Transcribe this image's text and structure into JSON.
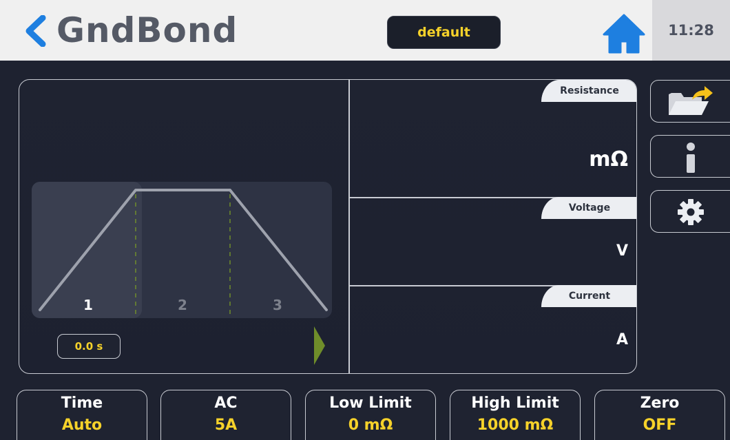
{
  "header": {
    "title": "GndBond",
    "profile": "default",
    "clock": "11:28",
    "icons": {
      "back": "chevron-left-icon",
      "home": "home-icon"
    },
    "colors": {
      "accent_blue": "#1e7fe0",
      "value_yellow": "#f6d22a",
      "play_green": "#6f8d2a"
    }
  },
  "graph": {
    "step_labels": [
      "1",
      "2",
      "3"
    ],
    "active_step": 1,
    "timer": "0.0 s"
  },
  "measurements": [
    {
      "label": "Resistance",
      "unit": "mΩ"
    },
    {
      "label": "Voltage",
      "unit": "V"
    },
    {
      "label": "Current",
      "unit": "A"
    }
  ],
  "side_buttons": [
    {
      "icon": "folder-open-icon"
    },
    {
      "icon": "info-icon"
    },
    {
      "icon": "gear-icon"
    }
  ],
  "parameters": [
    {
      "label": "Time",
      "value": "Auto"
    },
    {
      "label": "AC",
      "value": "5A"
    },
    {
      "label": "Low Limit",
      "value": "0 mΩ"
    },
    {
      "label": "High Limit",
      "value": "1000 mΩ"
    },
    {
      "label": "Zero",
      "value": "OFF"
    }
  ]
}
